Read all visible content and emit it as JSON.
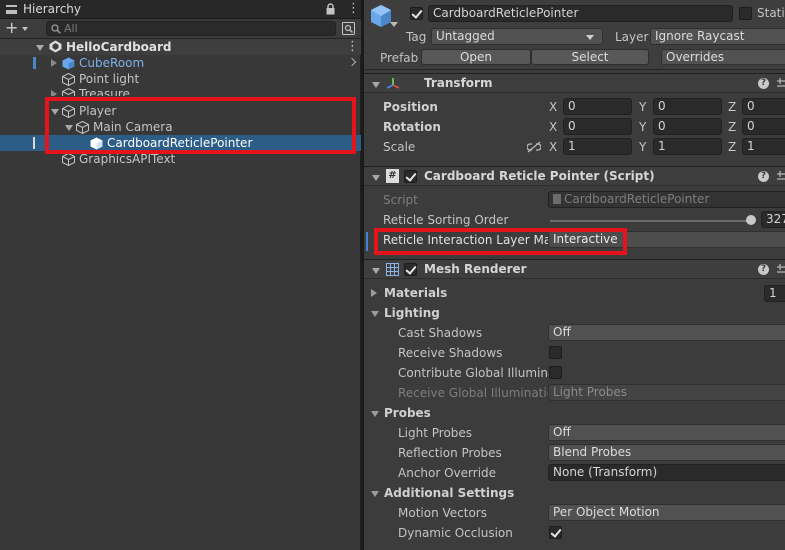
{
  "hierarchy": {
    "tab_title": "Hierarchy",
    "search_placeholder": "All",
    "add_label": "+",
    "scene": "HelloCardboard",
    "items": [
      {
        "label": "CubeRoom"
      },
      {
        "label": "Point light"
      },
      {
        "label": "Treasure"
      },
      {
        "label": "Player"
      },
      {
        "label": "Main Camera"
      },
      {
        "label": "CardboardReticlePointer"
      },
      {
        "label": "GraphicsAPIText"
      }
    ]
  },
  "inspector": {
    "object_name": "CardboardReticlePointer",
    "static_label": "Static",
    "tag_label": "Tag",
    "tag_value": "Untagged",
    "layer_label": "Layer",
    "layer_value": "Ignore Raycast",
    "prefab_label": "Prefab",
    "open_label": "Open",
    "select_label": "Select",
    "overrides_label": "Overrides",
    "transform": {
      "title": "Transform",
      "position_label": "Position",
      "rotation_label": "Rotation",
      "scale_label": "Scale",
      "x": "X",
      "y": "Y",
      "z": "Z",
      "position": [
        "0",
        "0",
        "0"
      ],
      "rotation": [
        "0",
        "0",
        "0"
      ],
      "scale": [
        "1",
        "1",
        "1"
      ]
    },
    "script_comp": {
      "title": "Cardboard Reticle Pointer (Script)",
      "script_label": "Script",
      "script_value": "CardboardReticlePointer",
      "sorting_label": "Reticle Sorting Order",
      "sorting_value": "327",
      "interaction_label": "Reticle Interaction Layer Ma",
      "interaction_value": "Interactive"
    },
    "mesh_renderer": {
      "title": "Mesh Renderer",
      "materials_label": "Materials",
      "materials_count": "1",
      "lighting_label": "Lighting",
      "cast_shadows_label": "Cast Shadows",
      "cast_shadows_value": "Off",
      "receive_shadows_label": "Receive Shadows",
      "contribute_gi_label": "Contribute Global Illuminat",
      "receive_gi_label": "Receive Global Illuminatio",
      "receive_gi_value": "Light Probes",
      "probes_label": "Probes",
      "light_probes_label": "Light Probes",
      "light_probes_value": "Off",
      "reflection_probes_label": "Reflection Probes",
      "reflection_probes_value": "Blend Probes",
      "anchor_override_label": "Anchor Override",
      "anchor_override_value": "None (Transform)",
      "additional_label": "Additional Settings",
      "motion_vectors_label": "Motion Vectors",
      "motion_vectors_value": "Per Object Motion",
      "dynamic_occlusion_label": "Dynamic Occlusion"
    }
  },
  "colors": {
    "selection": "#2c5d87",
    "highlight_box": "#e3141c",
    "prefab_blue": "#7fb1ea"
  }
}
